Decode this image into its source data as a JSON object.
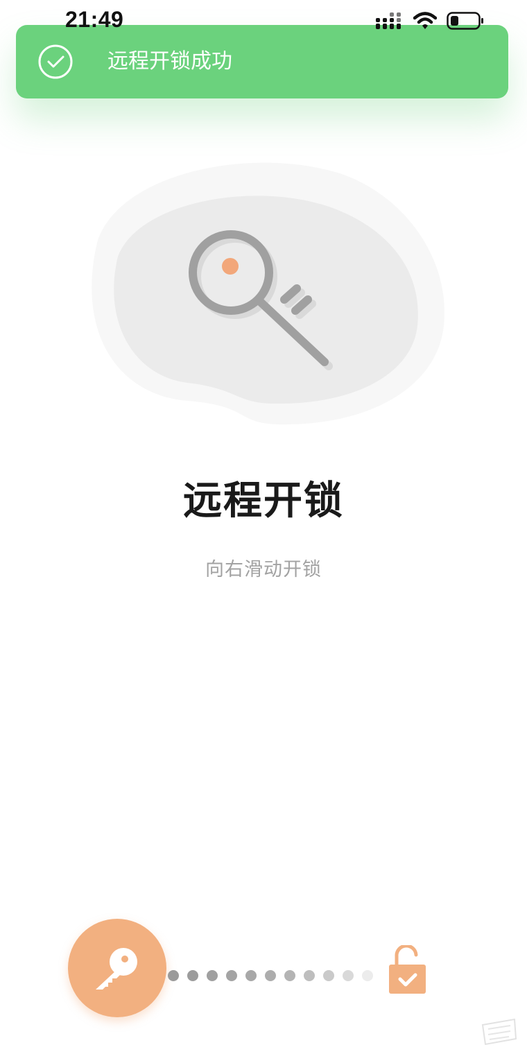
{
  "status_bar": {
    "time": "21:49",
    "icons": [
      "signal-icon",
      "wifi-icon",
      "battery-icon"
    ]
  },
  "toast": {
    "message": "远程开锁成功",
    "icon": "check-circle-icon",
    "color": "#6bd27d"
  },
  "hero": {
    "icon": "key-illustration"
  },
  "main": {
    "title": "远程开锁",
    "subtitle": "向右滑动开锁"
  },
  "slider": {
    "knob_icon": "key-icon",
    "target_icon": "unlock-icon",
    "accent_color": "#f2b080"
  }
}
